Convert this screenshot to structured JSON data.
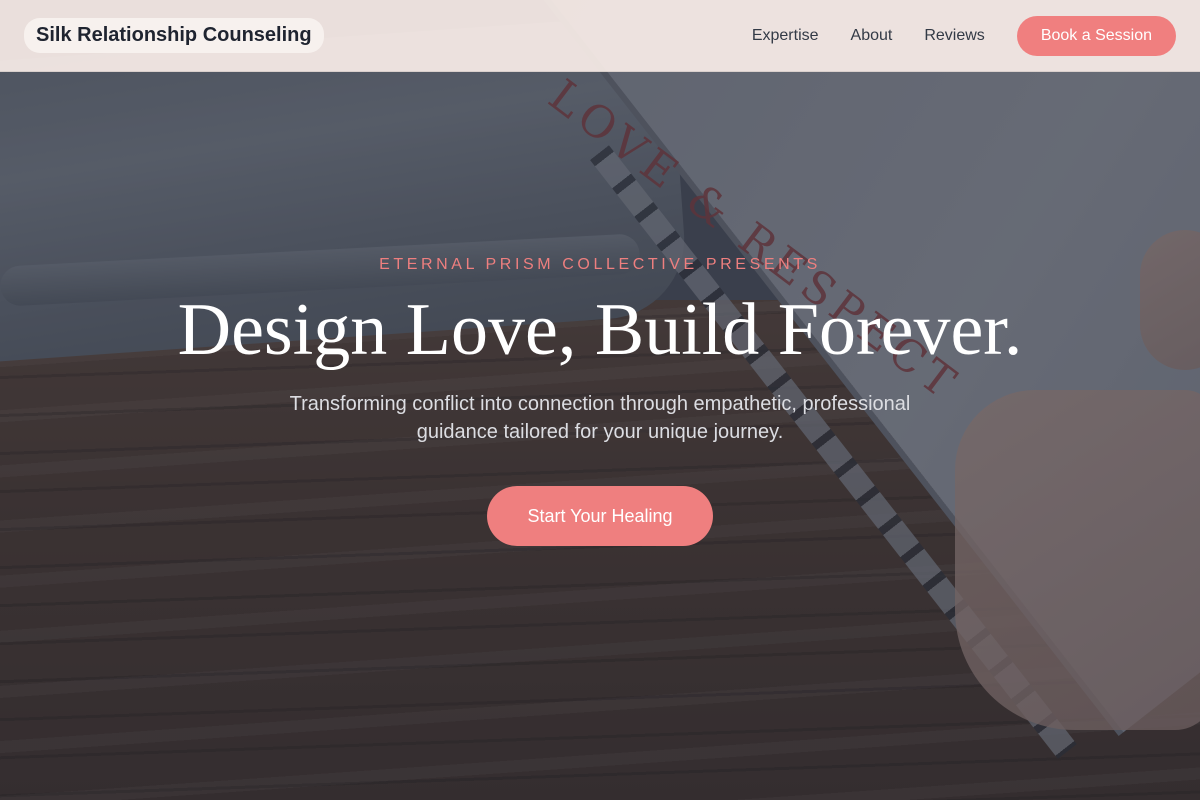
{
  "header": {
    "brand": "Silk Relationship Counseling",
    "nav": [
      "Expertise",
      "About",
      "Reviews"
    ],
    "cta_label": "Book a Session"
  },
  "hero": {
    "eyebrow": "ETERNAL PRISM COLLECTIVE PRESENTS",
    "headline": "Design Love, Build Forever.",
    "subtitle": "Transforming conflict into connection through empathetic, professional guidance tailored for your unique journey.",
    "cta_label": "Start Your Healing",
    "background_image_text": "LOVE & RESPECT"
  },
  "colors": {
    "accent": "#f07f7f",
    "header_bg": "#f5eae6",
    "text_dark": "#1f2430"
  }
}
